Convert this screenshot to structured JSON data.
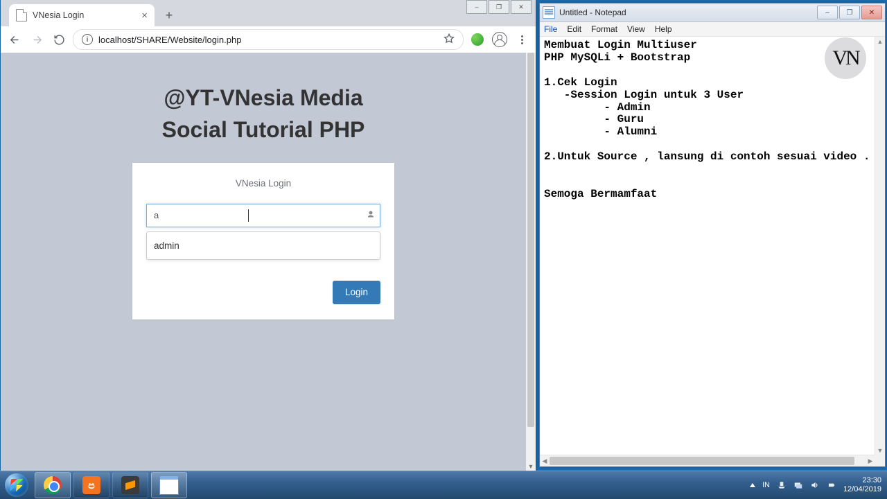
{
  "chrome": {
    "tab_title": "VNesia Login",
    "url": "localhost/SHARE/Website/login.php",
    "window_buttons": {
      "min": "–",
      "max": "❐",
      "close": "✕"
    }
  },
  "page": {
    "heading_l1": "@YT-VNesia Media",
    "heading_l2": "Social Tutorial PHP",
    "card_title": "VNesia Login",
    "username_value": "a",
    "autocomplete_item": "admin",
    "login_button": "Login"
  },
  "notepad": {
    "title": "Untitled - Notepad",
    "menu": [
      "File",
      "Edit",
      "Format",
      "View",
      "Help"
    ],
    "lines": [
      {
        "t": "Membuat Login Multiuser",
        "b": true
      },
      {
        "t": "PHP MySQLi + Bootstrap",
        "b": true
      },
      {
        "t": "",
        "b": false
      },
      {
        "t": "1.Cek Login",
        "b": true
      },
      {
        "t": "   -Session Login untuk 3 User",
        "b": true
      },
      {
        "t": "         - Admin",
        "b": true
      },
      {
        "t": "         - Guru",
        "b": true
      },
      {
        "t": "         - Alumni",
        "b": true
      },
      {
        "t": "",
        "b": false
      },
      {
        "t": "2.Untuk Source , lansung di contoh sesuai video .",
        "b": true
      },
      {
        "t": "",
        "b": false
      },
      {
        "t": "",
        "b": false
      },
      {
        "t": "Semoga Bermamfaat",
        "b": true
      }
    ]
  },
  "watermark": "VN",
  "tray": {
    "lang": "IN",
    "time": "23:30",
    "date": "12/04/2019"
  }
}
